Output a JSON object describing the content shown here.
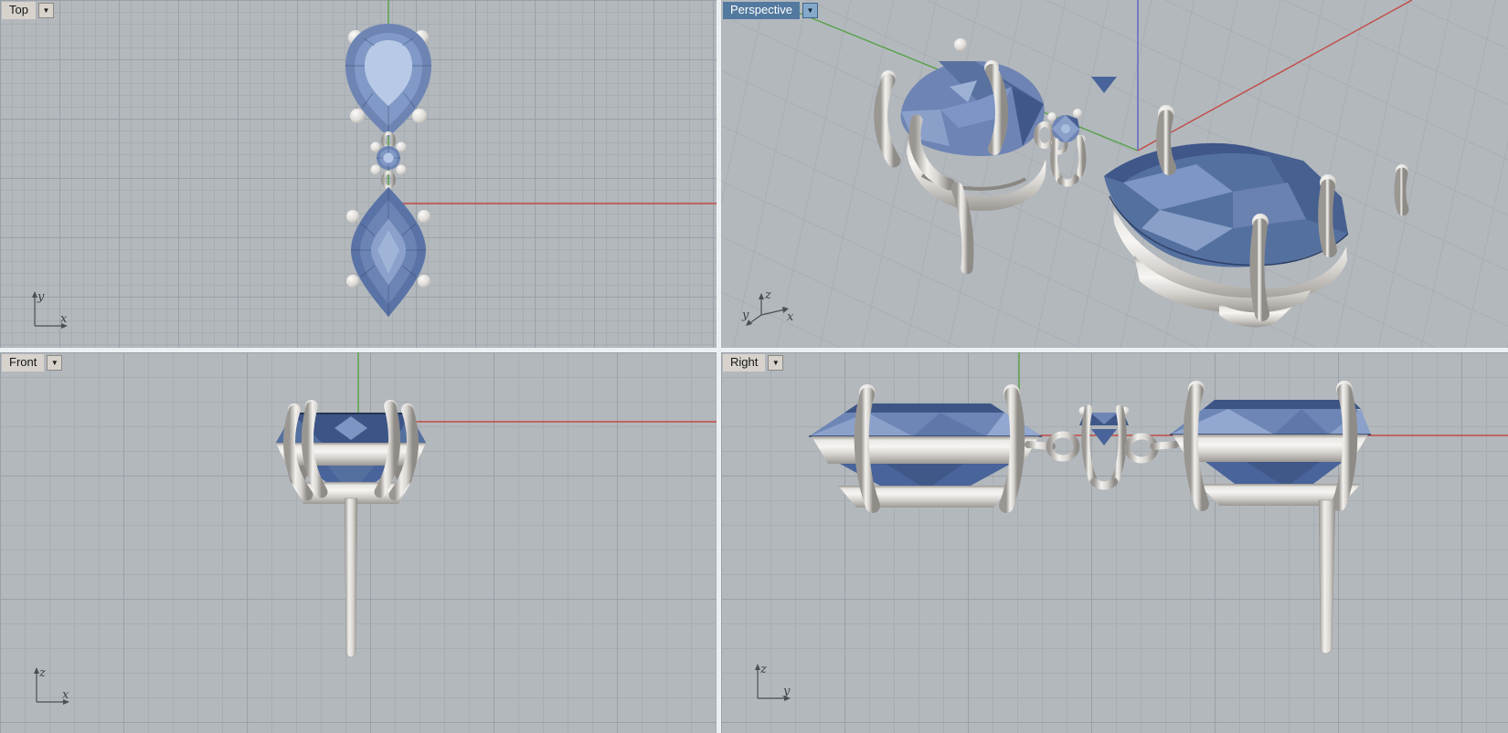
{
  "viewports": {
    "top": {
      "label": "Top",
      "active": false,
      "axis_indicator": {
        "vertical": "y",
        "horizontal": "x"
      }
    },
    "perspective": {
      "label": "Perspective",
      "active": true,
      "axis_indicator": {
        "up": "z",
        "left": "y",
        "right": "x"
      }
    },
    "front": {
      "label": "Front",
      "active": false,
      "axis_indicator": {
        "vertical": "z",
        "horizontal": "x"
      }
    },
    "right": {
      "label": "Right",
      "active": false,
      "axis_indicator": {
        "vertical": "z",
        "horizontal": "y"
      }
    }
  },
  "icons": {
    "viewport_menu": "▼"
  },
  "colors": {
    "viewport_bg": "#b3b8bd",
    "grid_minor": "#a8adb2",
    "grid_major": "#9aa0a6",
    "divider": "#edf0f2",
    "axis_red": "#c24a44",
    "axis_green": "#55a245",
    "axis_blue": "#5d63c2",
    "label_bg": "#d7d3cc",
    "label_active_bg": "#53799f",
    "label_active_text": "#ffffff",
    "metal_light": "#f4f2ef",
    "metal_mid": "#d6d3cf",
    "metal_dark": "#9b9894",
    "gem_table_light": "#b7c9e6",
    "gem_mid": "#6e85b4",
    "gem_dark": "#49639b"
  }
}
